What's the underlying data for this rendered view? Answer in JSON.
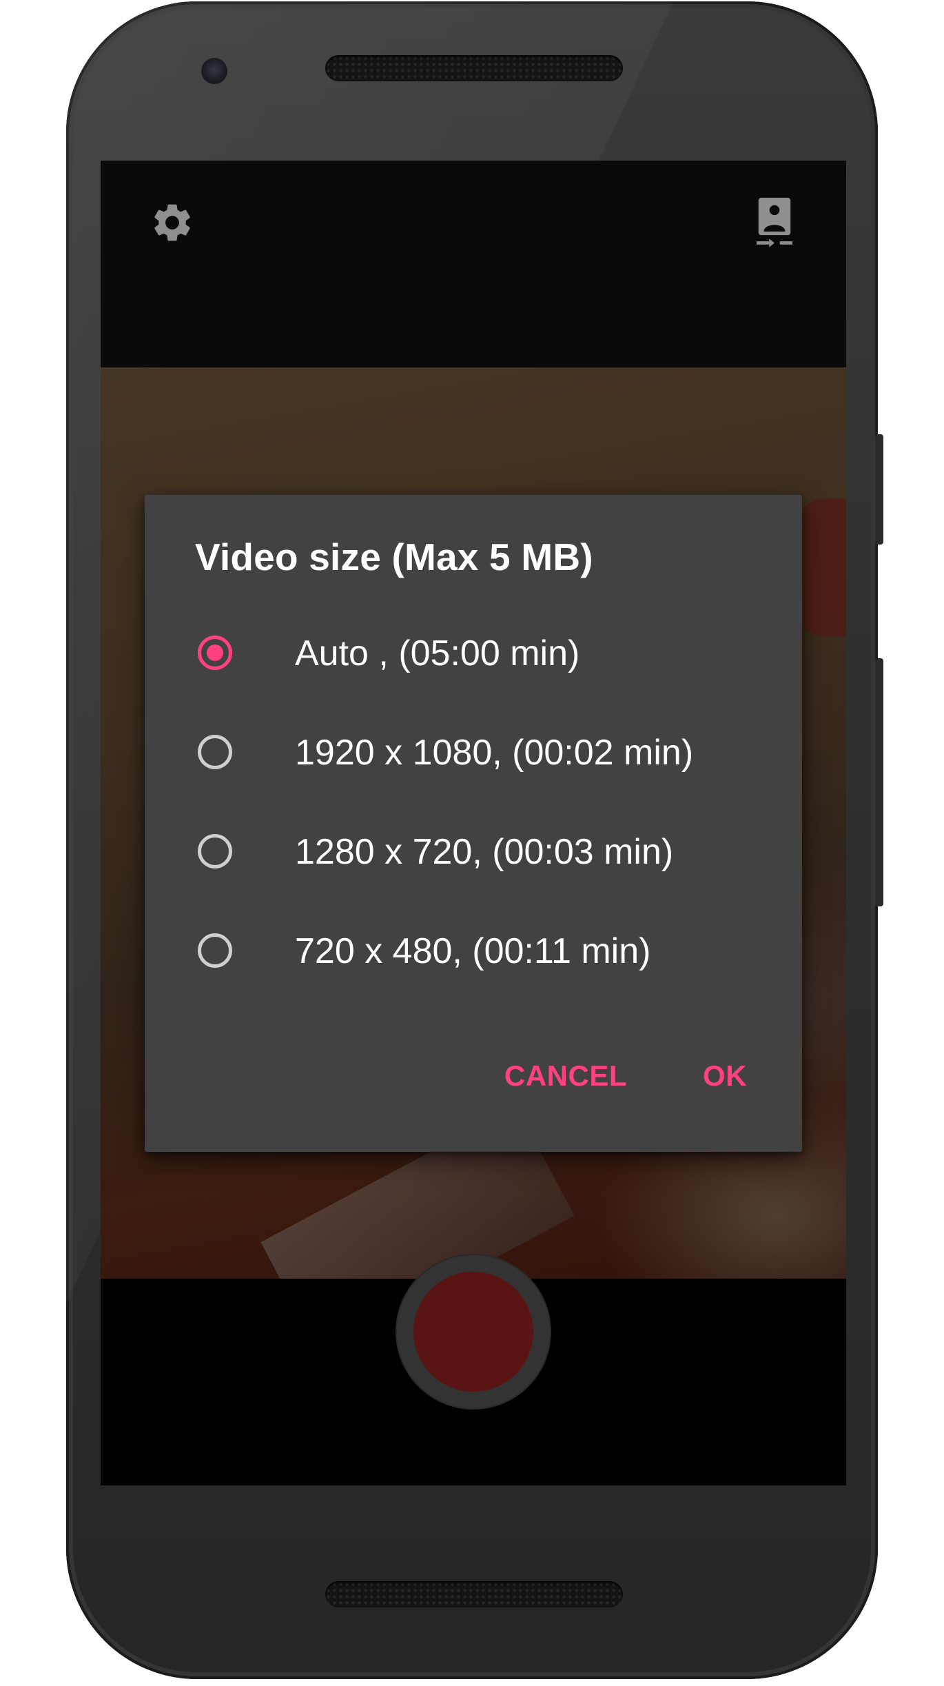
{
  "dialog": {
    "title": "Video size (Max 5 MB)",
    "options": [
      {
        "label": "Auto , (05:00 min)",
        "checked": true
      },
      {
        "label": "1920 x 1080, (00:02 min)",
        "checked": false
      },
      {
        "label": "1280 x 720, (00:03 min)",
        "checked": false
      },
      {
        "label": "720 x 480, (00:11 min)",
        "checked": false
      }
    ],
    "cancel_label": "CANCEL",
    "ok_label": "OK"
  },
  "colors": {
    "accent": "#ff4081",
    "dialog_bg": "#424242",
    "record": "#5a1414"
  },
  "icons": {
    "settings": "gear-icon",
    "switch_camera": "switch-camera-icon",
    "record": "record-button"
  }
}
